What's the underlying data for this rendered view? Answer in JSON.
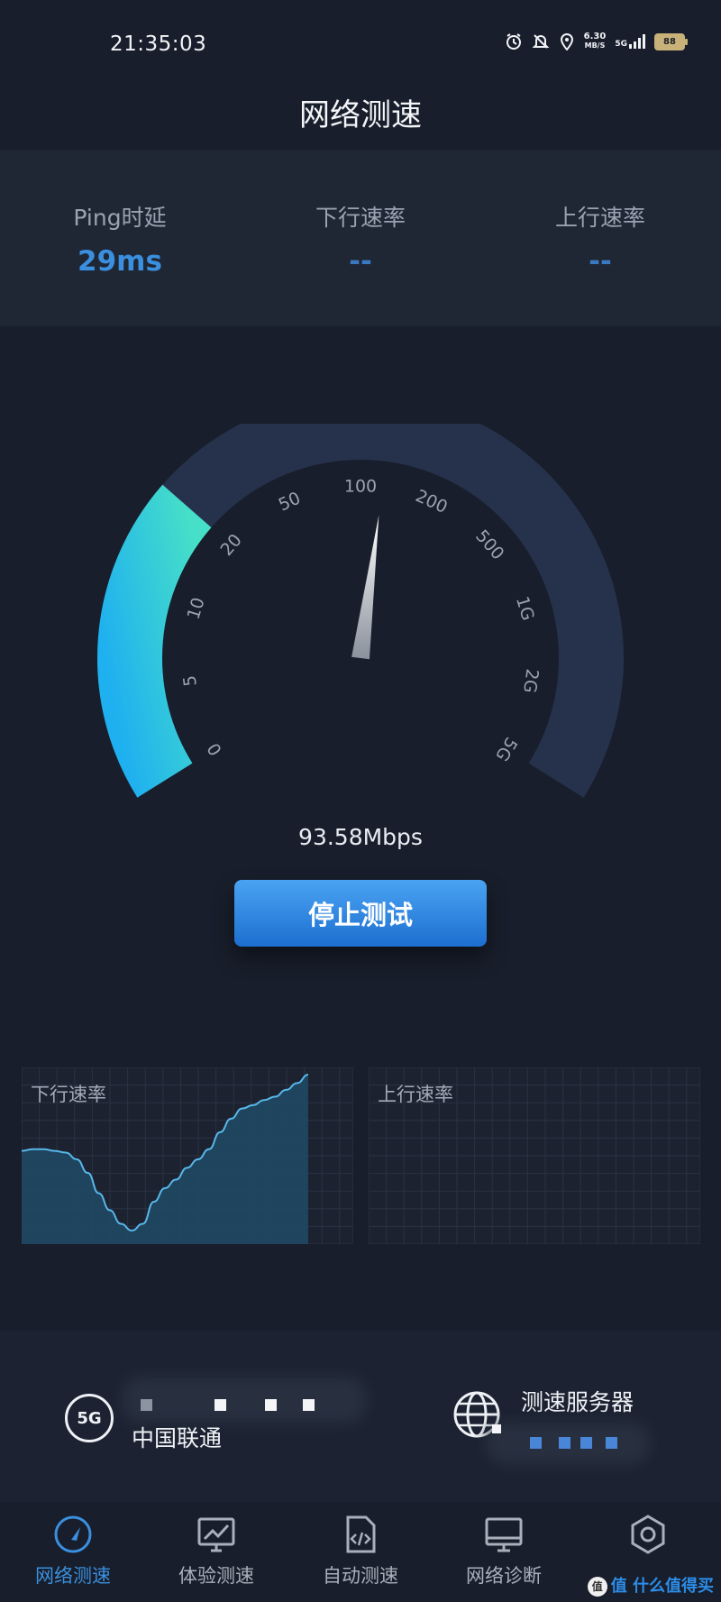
{
  "status_bar": {
    "time": "21:35:03",
    "net_speed_value": "6.30",
    "net_speed_unit": "MB/S",
    "network_type": "5G",
    "battery": "88"
  },
  "title": "网络测速",
  "metrics": [
    {
      "label": "Ping时延",
      "value": "29ms"
    },
    {
      "label": "下行速率",
      "value": "--"
    },
    {
      "label": "上行速率",
      "value": "--"
    }
  ],
  "gauge": {
    "ticks": [
      "0",
      "5",
      "10",
      "20",
      "50",
      "100",
      "200",
      "500",
      "1G",
      "2G",
      "5G"
    ],
    "reading": "93.58Mbps",
    "progress": 0.3,
    "needle_tick_position": 5.3
  },
  "stop_button": "停止测试",
  "graphs": {
    "download_label": "下行速率",
    "upload_label": "上行速率",
    "download_fraction": [
      0.55,
      0.56,
      0.56,
      0.55,
      0.54,
      0.5,
      0.42,
      0.3,
      0.2,
      0.12,
      0.08,
      0.12,
      0.25,
      0.33,
      0.38,
      0.45,
      0.5,
      0.56,
      0.66,
      0.74,
      0.8,
      0.82,
      0.85,
      0.87,
      0.91,
      0.95,
      1.0
    ]
  },
  "carrier": {
    "badge": "5G",
    "name": "中国联通"
  },
  "server": {
    "label": "测速服务器"
  },
  "tabs": [
    {
      "label": "网络测速",
      "icon": "speedometer-icon",
      "active": true
    },
    {
      "label": "体验测速",
      "icon": "monitor-chart-icon",
      "active": false
    },
    {
      "label": "自动测速",
      "icon": "code-file-icon",
      "active": false
    },
    {
      "label": "网络诊断",
      "icon": "desktop-icon",
      "active": false
    },
    {
      "label": "",
      "icon": "settings-hex-icon",
      "active": false
    }
  ],
  "watermark": "值 什么值得买",
  "colors": {
    "accent": "#3a8fde",
    "gauge_start": "#22a8e8",
    "gauge_end": "#3fd9c8",
    "gauge_track": "#26324b",
    "background": "#181e2b"
  }
}
